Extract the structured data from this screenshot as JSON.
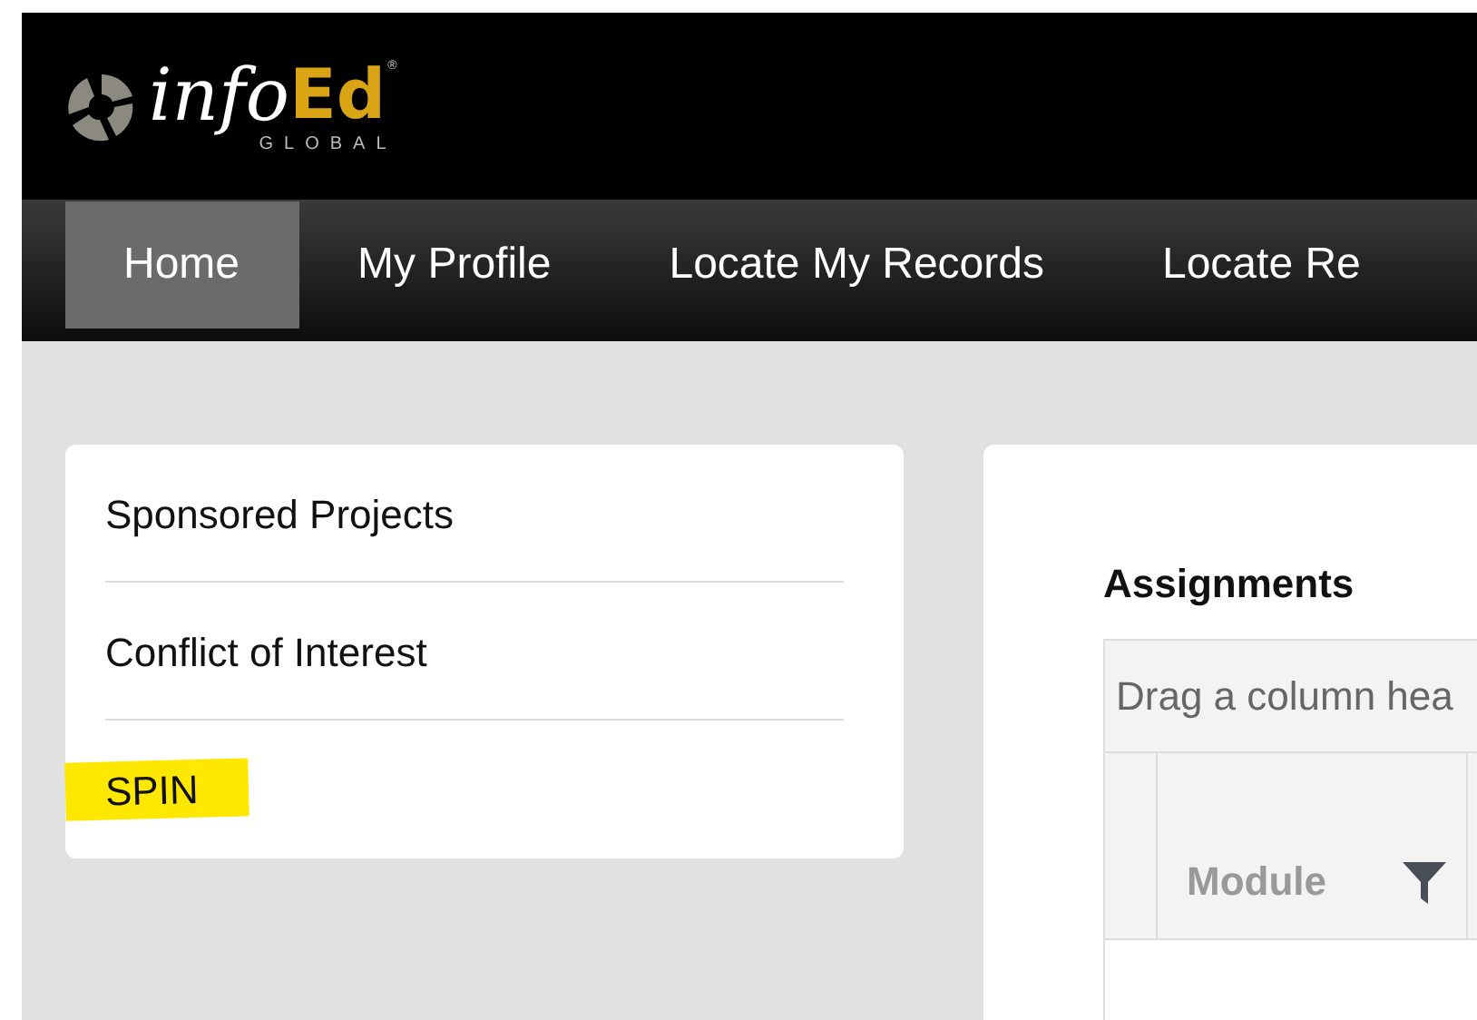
{
  "logo": {
    "brand_light": "info",
    "brand_bold": "Ed",
    "registered": "®",
    "tagline": "GLOBAL"
  },
  "nav": [
    {
      "label": "Home",
      "selected": true
    },
    {
      "label": "My Profile",
      "selected": false
    },
    {
      "label": "Locate My Records",
      "selected": false
    },
    {
      "label": "Locate Re",
      "selected": false
    }
  ],
  "modules": [
    {
      "label": "Sponsored Projects",
      "highlighted": false
    },
    {
      "label": "Conflict of Interest",
      "highlighted": false
    },
    {
      "label": "SPIN",
      "highlighted": true
    }
  ],
  "assignments": {
    "title": "Assignments",
    "group_hint": "Drag a column hea",
    "columns": [
      "Module"
    ]
  }
}
